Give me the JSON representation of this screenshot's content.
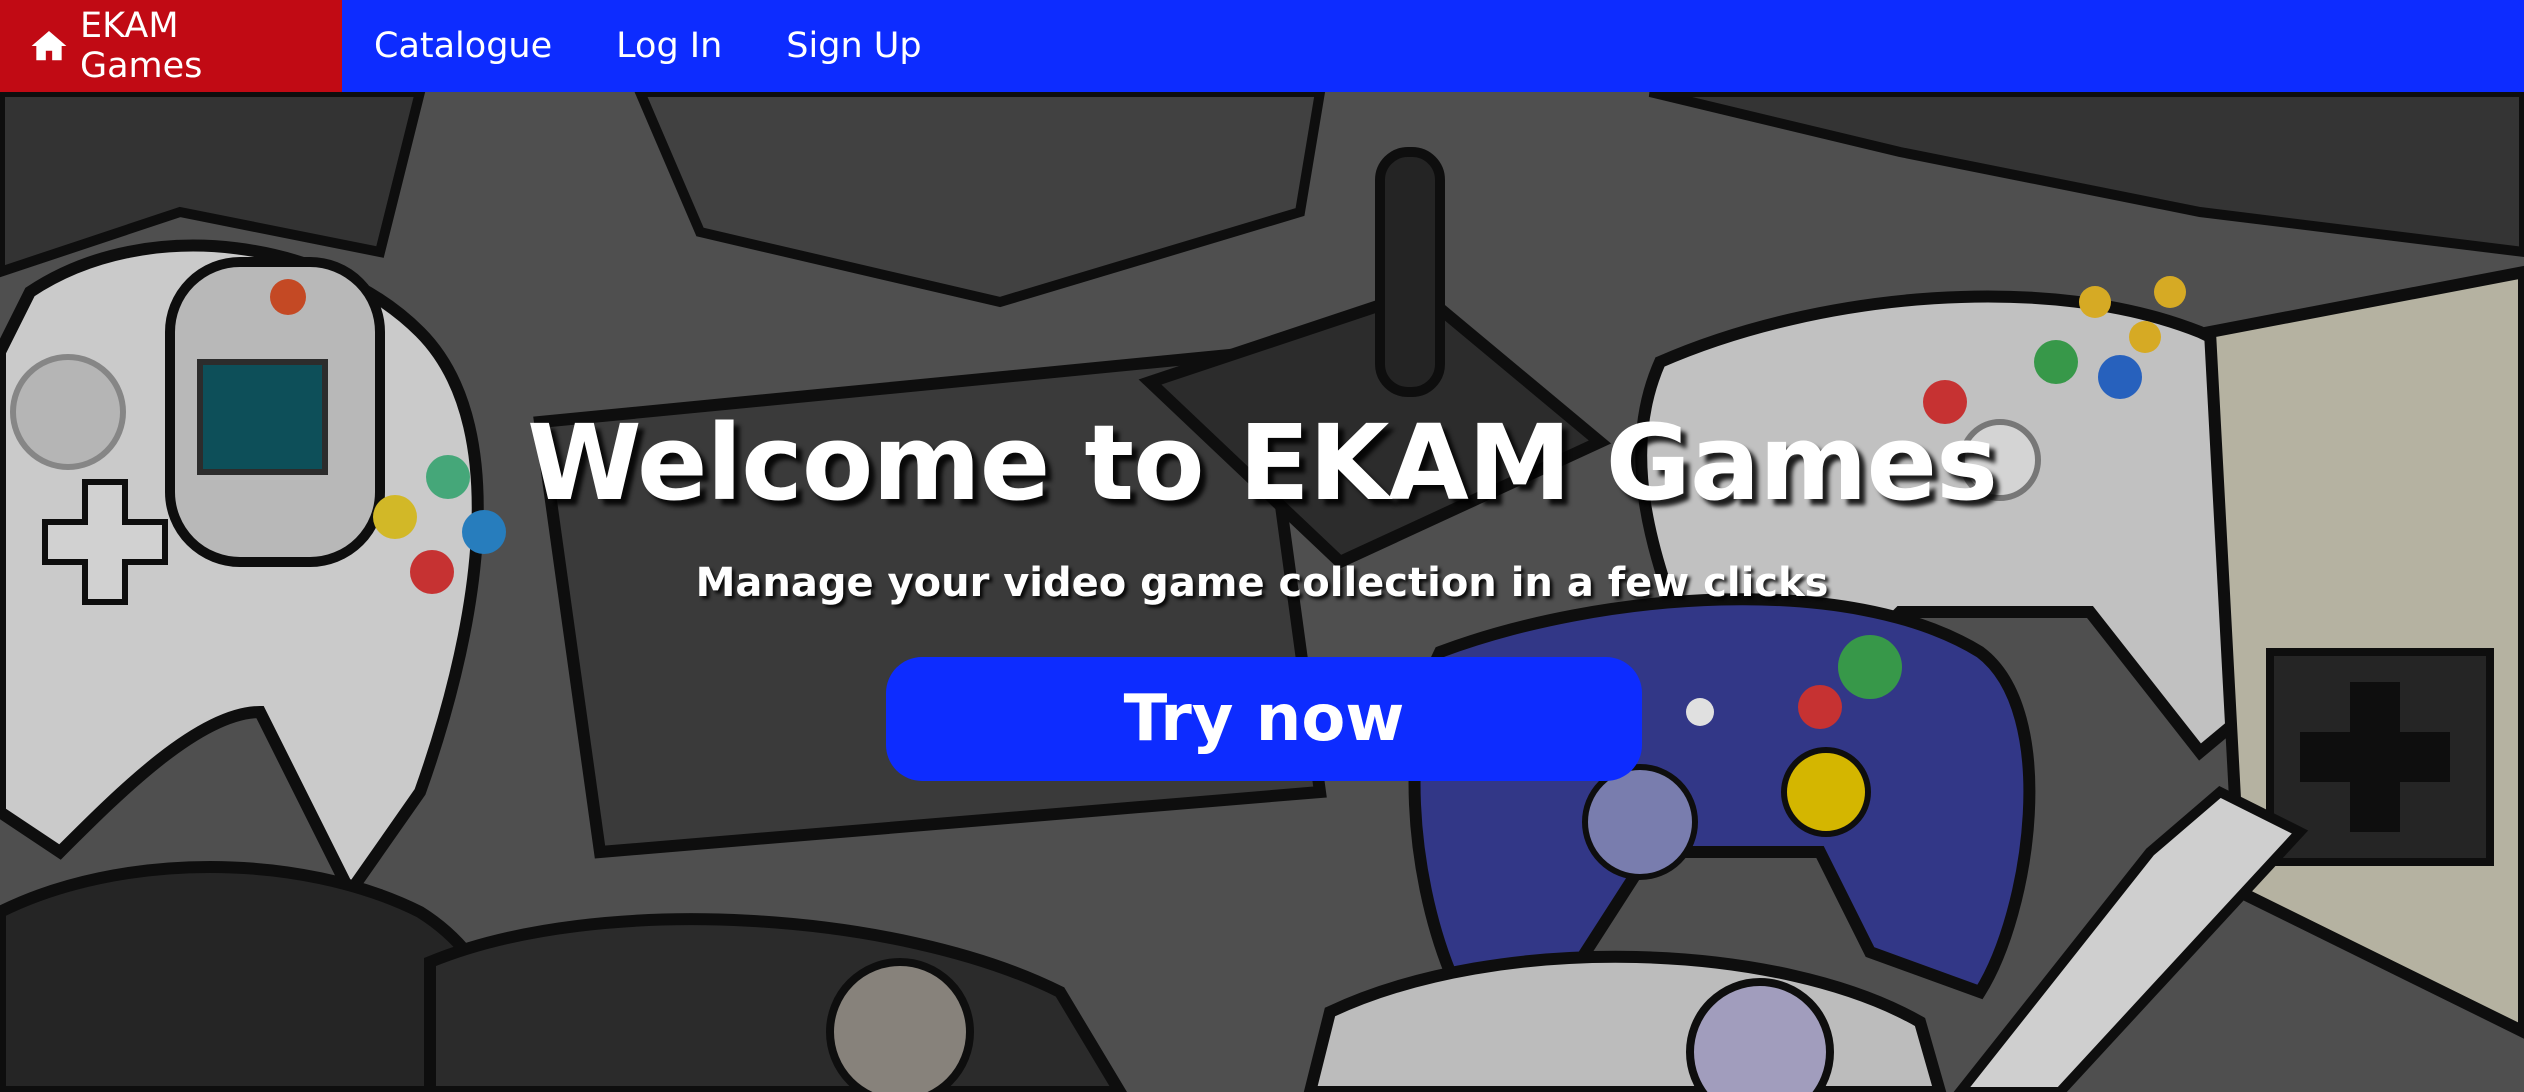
{
  "navbar": {
    "brand_label": "EKAM Games",
    "brand_icon": "home-icon",
    "links": [
      "Catalogue",
      "Log In",
      "Sign Up"
    ],
    "colors": {
      "bar": "#0d2cff",
      "brand": "#c10a14"
    }
  },
  "hero": {
    "title": "Welcome to EKAM Games",
    "subtitle": "Manage your video game collection in a few clicks",
    "cta_label": "Try now",
    "background": "game-controllers-illustration"
  }
}
